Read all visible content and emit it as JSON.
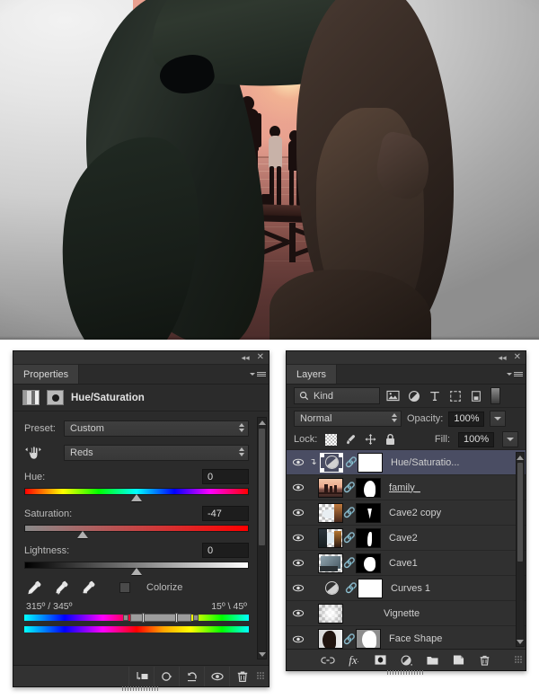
{
  "app": "Adobe Photoshop",
  "artwork": {
    "alt_description": "Double exposure of a woman's head silhouette containing a sunset beach scene with a family of four on a pier"
  },
  "properties_panel": {
    "tab_label": "Properties",
    "titlebar": {
      "collapse_icon": "collapse-double-arrow-icon",
      "close_icon": "close-icon"
    },
    "menu_icon": "panel-menu-icon",
    "adjustment_title": "Hue/Saturation",
    "header_icons": {
      "adjustment": "adjustment-layer-icon",
      "mask": "layer-mask-icon"
    },
    "preset": {
      "label": "Preset:",
      "value": "Custom"
    },
    "target_tool_icon": "on-image-adjustment-hand-icon",
    "channel": {
      "value": "Reds"
    },
    "sliders": [
      {
        "label": "Hue:",
        "value": "0",
        "thumb_pct": 50,
        "gradient": "hue"
      },
      {
        "label": "Saturation:",
        "value": "-47",
        "thumb_pct": 26,
        "gradient": "saturation"
      },
      {
        "label": "Lightness:",
        "value": "0",
        "thumb_pct": 50,
        "gradient": "lightness"
      }
    ],
    "eyedroppers": [
      "eyedropper-icon",
      "eyedropper-add-icon",
      "eyedropper-subtract-icon"
    ],
    "colorize": {
      "label": "Colorize",
      "checked": false
    },
    "range_left": "315º / 345º",
    "range_right": "15º \\ 45º",
    "footer_buttons": [
      "clip-to-layer-icon",
      "toggle-previous-state-icon",
      "reset-icon",
      "toggle-visibility-icon",
      "delete-icon"
    ]
  },
  "layers_panel": {
    "tab_label": "Layers",
    "titlebar": {
      "collapse_icon": "collapse-double-arrow-icon",
      "close_icon": "close-icon"
    },
    "menu_icon": "panel-menu-icon",
    "filter": {
      "kind_label": "Kind",
      "search_icon": "search-icon",
      "type_icons": [
        "pixel-layer-filter-icon",
        "adjustment-layer-filter-icon",
        "type-layer-filter-icon",
        "shape-layer-filter-icon",
        "smart-object-filter-icon"
      ],
      "toggle_icon": "filter-toggle-switch"
    },
    "blend_mode": "Normal",
    "opacity": {
      "label": "Opacity:",
      "value": "100%"
    },
    "lock": {
      "label": "Lock:",
      "icons": [
        "lock-transparent-pixels-icon",
        "lock-image-pixels-icon",
        "lock-position-icon",
        "lock-all-icon"
      ]
    },
    "fill": {
      "label": "Fill:",
      "value": "100%"
    },
    "layers": [
      {
        "name": "Hue/Saturatio...",
        "selected": true,
        "visible": true,
        "thumb": "adjustment",
        "mask": "white",
        "linked": false,
        "clipped": true
      },
      {
        "name": "family_",
        "selected": false,
        "visible": true,
        "thumb": "photo-sunset",
        "mask": "head-shape",
        "linked": true,
        "clipped": false
      },
      {
        "name": "Cave2 copy",
        "selected": false,
        "visible": true,
        "thumb": "photo-cave2copy",
        "mask": "small-shape",
        "linked": true,
        "clipped": false
      },
      {
        "name": "Cave2",
        "selected": false,
        "visible": true,
        "thumb": "photo-cave2",
        "mask": "leaf-shape",
        "linked": true,
        "clipped": false
      },
      {
        "name": "Cave1",
        "selected": false,
        "visible": true,
        "thumb": "photo-cave1",
        "mask": "blob-shape",
        "linked": true,
        "clipped": false
      },
      {
        "name": "Curves 1",
        "selected": false,
        "visible": true,
        "thumb": "adjustment",
        "mask": "white",
        "linked": true,
        "clipped": false
      },
      {
        "name": "Vignette",
        "selected": false,
        "visible": true,
        "thumb": "checker",
        "mask": null,
        "linked": false,
        "clipped": false
      },
      {
        "name": "Face Shape",
        "selected": false,
        "visible": true,
        "thumb": "photo-face",
        "mask": "face-shape",
        "linked": true,
        "clipped": false
      }
    ],
    "footer_buttons": [
      "link-layers-icon",
      "layer-style-fx-icon",
      "add-layer-mask-icon",
      "new-adjustment-layer-icon",
      "new-group-icon",
      "new-layer-icon",
      "delete-layer-icon"
    ]
  },
  "colors": {
    "panel_bg": "#2b2b2b",
    "panel_header": "#333333",
    "selection": "#4a4d63",
    "text": "#c4c4c4",
    "canvas_bg": "#cfcfcf"
  }
}
